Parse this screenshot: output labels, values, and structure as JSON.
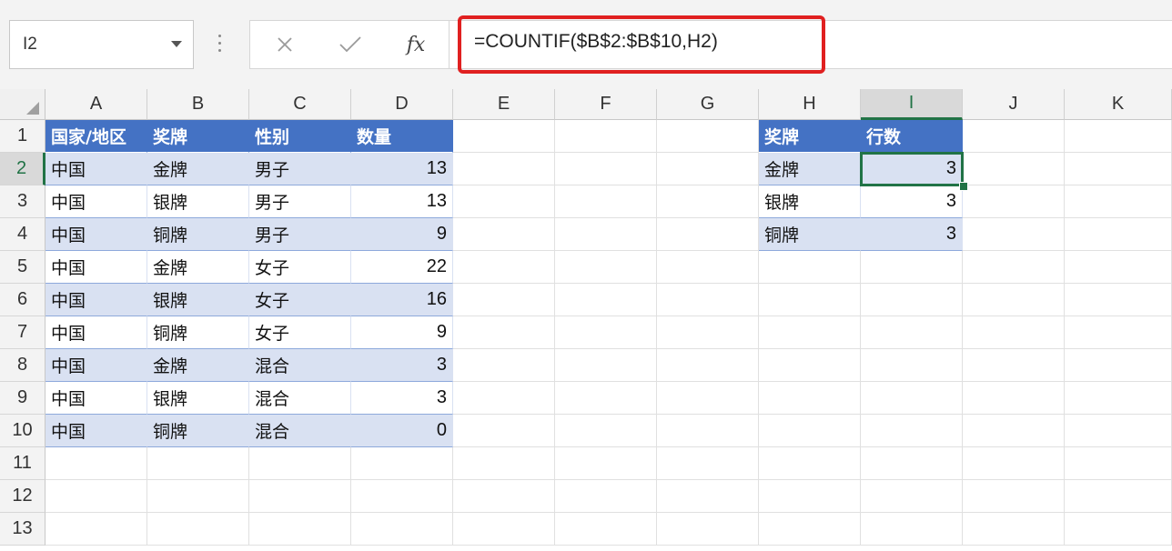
{
  "name_box": {
    "value": "I2"
  },
  "formula_bar": {
    "cancel_symbol": "✕",
    "enter_symbol": "✓",
    "fx_label": "fx",
    "formula": "=COUNTIF($B$2:$B$10,H2)"
  },
  "columns": [
    "A",
    "B",
    "C",
    "D",
    "E",
    "F",
    "G",
    "H",
    "I",
    "J",
    "K"
  ],
  "rows": [
    "1",
    "2",
    "3",
    "4",
    "5",
    "6",
    "7",
    "8",
    "9",
    "10",
    "11",
    "12",
    "13"
  ],
  "table1": {
    "headers": [
      "国家/地区",
      "奖牌",
      "性别",
      "数量"
    ],
    "rows": [
      [
        "中国",
        "金牌",
        "男子",
        "13"
      ],
      [
        "中国",
        "银牌",
        "男子",
        "13"
      ],
      [
        "中国",
        "铜牌",
        "男子",
        "9"
      ],
      [
        "中国",
        "金牌",
        "女子",
        "22"
      ],
      [
        "中国",
        "银牌",
        "女子",
        "16"
      ],
      [
        "中国",
        "铜牌",
        "女子",
        "9"
      ],
      [
        "中国",
        "金牌",
        "混合",
        "3"
      ],
      [
        "中国",
        "银牌",
        "混合",
        "3"
      ],
      [
        "中国",
        "铜牌",
        "混合",
        "0"
      ]
    ]
  },
  "table2": {
    "headers": [
      "奖牌",
      "行数"
    ],
    "rows": [
      [
        "金牌",
        "3"
      ],
      [
        "银牌",
        "3"
      ],
      [
        "铜牌",
        "3"
      ]
    ]
  },
  "colors": {
    "header_fill": "#4472c4",
    "band_fill": "#d9e1f2",
    "selection": "#217346",
    "highlight_box": "#e02020"
  },
  "icons": [
    "chevron-down-icon",
    "vertical-dots-icon",
    "close-icon",
    "check-icon",
    "function-icon",
    "select-all-icon"
  ]
}
